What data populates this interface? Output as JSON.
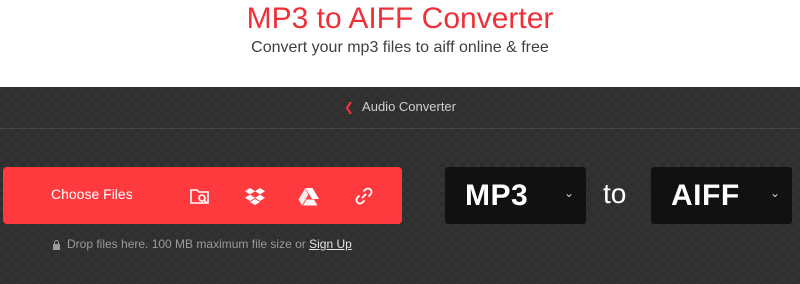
{
  "header": {
    "title": "MP3 to AIFF Converter",
    "subtitle": "Convert your mp3 files to aiff online & free"
  },
  "breadcrumb": {
    "label": "Audio Converter",
    "icon": "chevron-left-icon"
  },
  "upload": {
    "choose_label": "Choose Files",
    "icons": [
      "folder-search-icon",
      "dropbox-icon",
      "google-drive-icon",
      "link-icon"
    ],
    "hint_prefix": "Drop files here. 100 MB maximum file size or ",
    "signup_label": "Sign Up"
  },
  "conversion": {
    "from": "MP3",
    "to_word": "to",
    "to": "AIFF"
  },
  "colors": {
    "accent": "#ef3039",
    "button": "#ff3a3f",
    "panel": "#333333",
    "select_bg": "#111111"
  }
}
